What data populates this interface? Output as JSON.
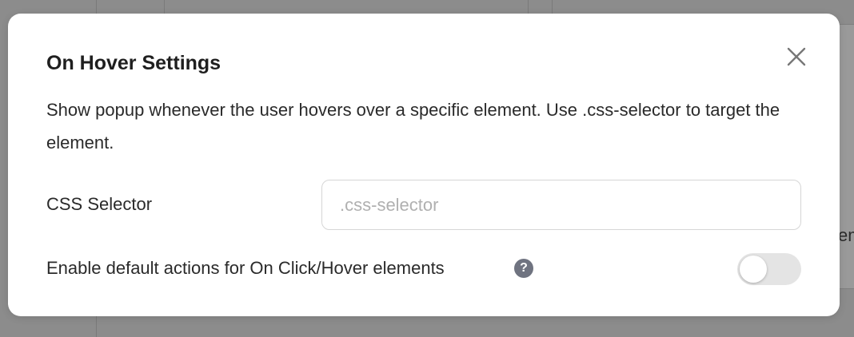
{
  "background": {
    "partial_text": "em"
  },
  "modal": {
    "title": "On Hover Settings",
    "close_icon": "close-icon",
    "description": "Show popup whenever the user hovers over a specific element. Use .css-selector to target the element.",
    "css_selector": {
      "label": "CSS Selector",
      "value": "",
      "placeholder": ".css-selector"
    },
    "default_actions": {
      "label": "Enable default actions for On Click/Hover elements",
      "help_icon": "question-mark-icon",
      "help_glyph": "?",
      "enabled": false
    }
  },
  "colors": {
    "overlay": "#8c8c8c",
    "modal_bg": "#ffffff",
    "help_icon_bg": "#6f7380",
    "toggle_off": "#e4e4e4"
  }
}
